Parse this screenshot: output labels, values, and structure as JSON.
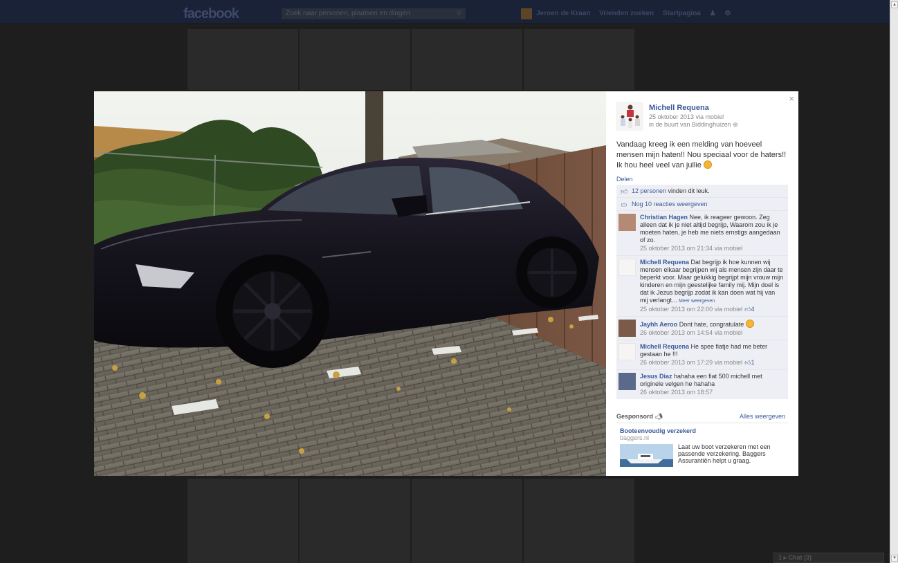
{
  "app": {
    "logo": "facebook",
    "search_placeholder": "Zoek naar personen, plaatsen en dingen",
    "nav": [
      "Jeroen de Kraan",
      "Vrienden zoeken",
      "Startpagina"
    ],
    "chat_label": "1 ▸ Chat (3)"
  },
  "post": {
    "author": "Michell Requena",
    "date": "25 oktober 2013 via mobiel",
    "location": "in de buurt van Biddinghuizen",
    "text": "Vandaag kreeg ik een melding van hoeveel mensen mijn haten!! Nou speciaal voor de haters!! Ik hou heel veel van jullie",
    "share_label": "Delen",
    "close_label": "×"
  },
  "likes": {
    "count_link": "12 personen",
    "suffix": " vinden dit leuk."
  },
  "more_comments": "Nog 10 reacties weergeven",
  "comments": [
    {
      "name": "Christian Hagen",
      "text": "Nee, ik reageer gewoon. Zeg alleen dat ik je niet altijd begrijp, Waarom zou ik je moeten haten, je heb me niets ernstigs aangedaan of zo.",
      "time": "25 oktober 2013 om 21:34 via mobiel",
      "likes": "",
      "more": ""
    },
    {
      "name": "Michell Requena",
      "text": "Dat begrijp ik hoe kunnen wij mensen elkaar begrijpen wij als mensen zijn daar te beperkt voor. Maar gelukkig begrijpt mijn vrouw mijn kinderen en mijn geestelijke family mij. Mijn doel is dat ik Jezus begrijp zodat ik kan doen wat hij van mij verlangt...",
      "time": "25 oktober 2013 om 22:00 via mobiel",
      "likes": "4",
      "more": "Meer weergeven"
    },
    {
      "name": "Jayhh Aeroo",
      "text": "Dont hate, congratulate",
      "time": "26 oktober 2013 om 14:54 via mobiel",
      "likes": "",
      "more": ""
    },
    {
      "name": "Michell Requena",
      "text": "He spee fiatje had me beter gestaan he !!!",
      "time": "26 oktober 2013 om 17:29 via mobiel",
      "likes": "1",
      "more": ""
    },
    {
      "name": "Jesus Diaz",
      "text": "hahaha een fiat 500 michell met originele velgen he hahaha",
      "time": "26 oktober 2013 om 18:57",
      "likes": "",
      "more": ""
    }
  ],
  "sponsored": {
    "title": "Gesponsord",
    "all_label": "Alles weergeven",
    "ad_title": "Booteenvoudig verzekerd",
    "ad_domain": "baggers.nl",
    "ad_text": "Laat uw boot verzekeren met een passende verzekering. Baggers Assurantiën helpt u graag."
  },
  "colors": {
    "link": "#3b5998",
    "overlay": "#1e1e1e",
    "ufi_bg": "#edeff4"
  }
}
